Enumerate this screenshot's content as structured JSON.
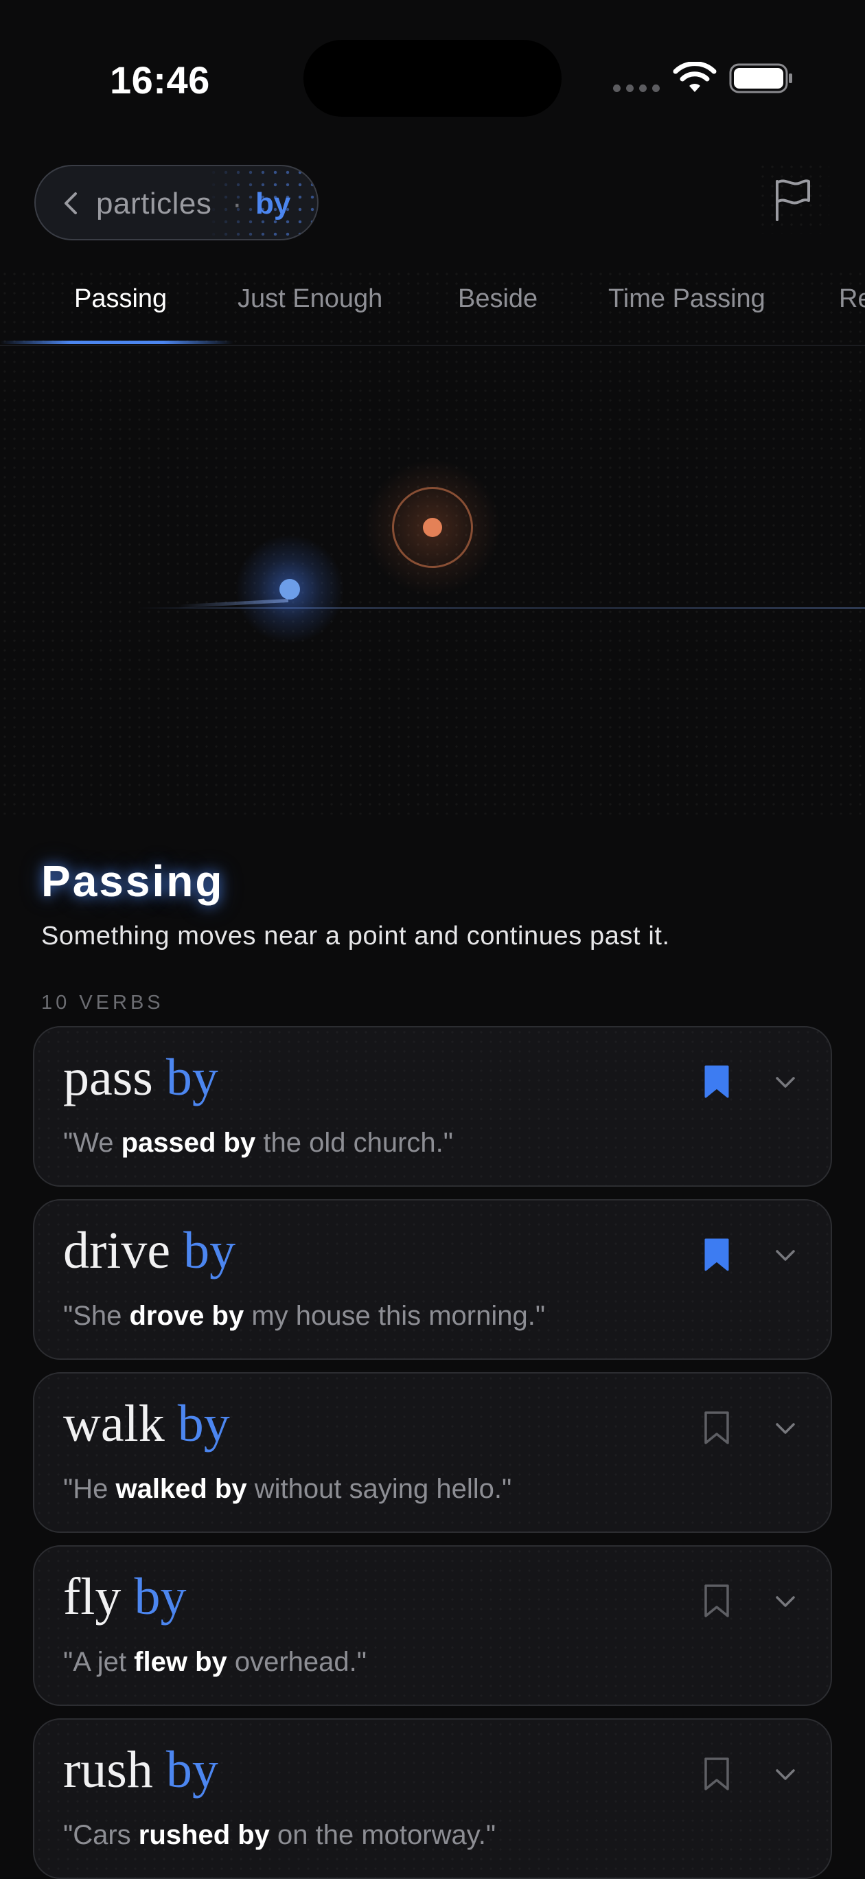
{
  "status_bar": {
    "time": "16:46",
    "icons": [
      "cellular-signal-icon",
      "wifi-icon",
      "battery-icon"
    ]
  },
  "header": {
    "back_icon": "chevron-left-icon",
    "breadcrumb_parent": "particles",
    "breadcrumb_separator": "·",
    "breadcrumb_current": "by",
    "flag_icon": "flag-icon"
  },
  "tabs": [
    {
      "label": "Passing",
      "active": true
    },
    {
      "label": "Just Enough",
      "active": false
    },
    {
      "label": "Beside",
      "active": false
    },
    {
      "label": "Time Passing",
      "active": false
    },
    {
      "label": "Re",
      "active": false
    }
  ],
  "sense": {
    "title": "Passing",
    "description": "Something moves near a point and continues past it.",
    "verb_count": "10 VERBS"
  },
  "verbs": [
    {
      "verb": "pass",
      "particle": "by",
      "bookmarked": true,
      "example_pre": "\"We ",
      "example_bold": "passed by",
      "example_post": " the old church.\""
    },
    {
      "verb": "drive",
      "particle": "by",
      "bookmarked": true,
      "example_pre": "\"She ",
      "example_bold": "drove by",
      "example_post": " my house this morning.\""
    },
    {
      "verb": "walk",
      "particle": "by",
      "bookmarked": false,
      "example_pre": "\"He ",
      "example_bold": "walked by",
      "example_post": " without saying hello.\""
    },
    {
      "verb": "fly",
      "particle": "by",
      "bookmarked": false,
      "example_pre": "\"A jet ",
      "example_bold": "flew by",
      "example_post": " overhead.\""
    },
    {
      "verb": "rush",
      "particle": "by",
      "bookmarked": false,
      "example_pre": "\"Cars ",
      "example_bold": "rushed by",
      "example_post": " on the motorway.\""
    }
  ],
  "colors": {
    "accent": "#4c86f0",
    "background": "#0b0b0c",
    "target": "#e48157",
    "bookmark_active": "#3d7cf2",
    "bookmark_inactive": "#5e5f64"
  }
}
